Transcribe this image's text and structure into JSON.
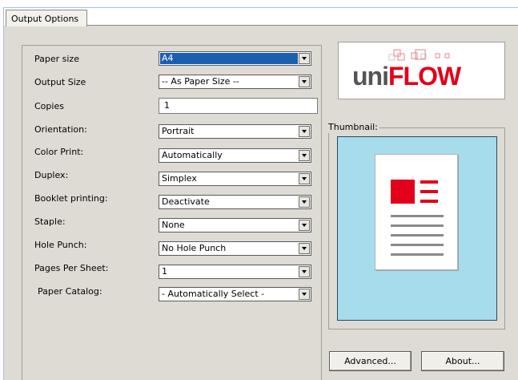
{
  "tabs": [
    {
      "label": "Output Options"
    }
  ],
  "settings": {
    "paper_size": {
      "label": "Paper size",
      "value": "A4"
    },
    "output_size": {
      "label": "Output Size",
      "value": "-- As Paper Size --"
    },
    "copies": {
      "label": "Copies",
      "value": "1"
    },
    "orientation": {
      "label": "Orientation:",
      "value": "Portrait"
    },
    "color_print": {
      "label": "Color Print:",
      "value": "Automatically"
    },
    "duplex": {
      "label": "Duplex:",
      "value": "Simplex"
    },
    "booklet_printing": {
      "label": "Booklet printing:",
      "value": "Deactivate"
    },
    "staple": {
      "label": "Staple:",
      "value": "None"
    },
    "hole_punch": {
      "label": "Hole Punch:",
      "value": "No Hole Punch"
    },
    "pages_per_sheet": {
      "label": "Pages Per Sheet:",
      "value": "1"
    },
    "paper_catalog": {
      "label": "Paper Catalog:",
      "value": "- Automatically Select -"
    }
  },
  "logo": {
    "part1": "uni",
    "part2": "FLOW"
  },
  "thumbnail": {
    "label": "Thumbnail:"
  },
  "buttons": {
    "advanced": "Advanced...",
    "about": "About..."
  },
  "colors": {
    "brand_red": "#e3001b",
    "thumbnail_bg": "#a6dcec",
    "panel_bg": "#dedbd4",
    "selection": "#1b5fb0"
  },
  "icons": [
    "uniflow-logo",
    "document-preview-icon",
    "dropdown-arrow-icon"
  ]
}
